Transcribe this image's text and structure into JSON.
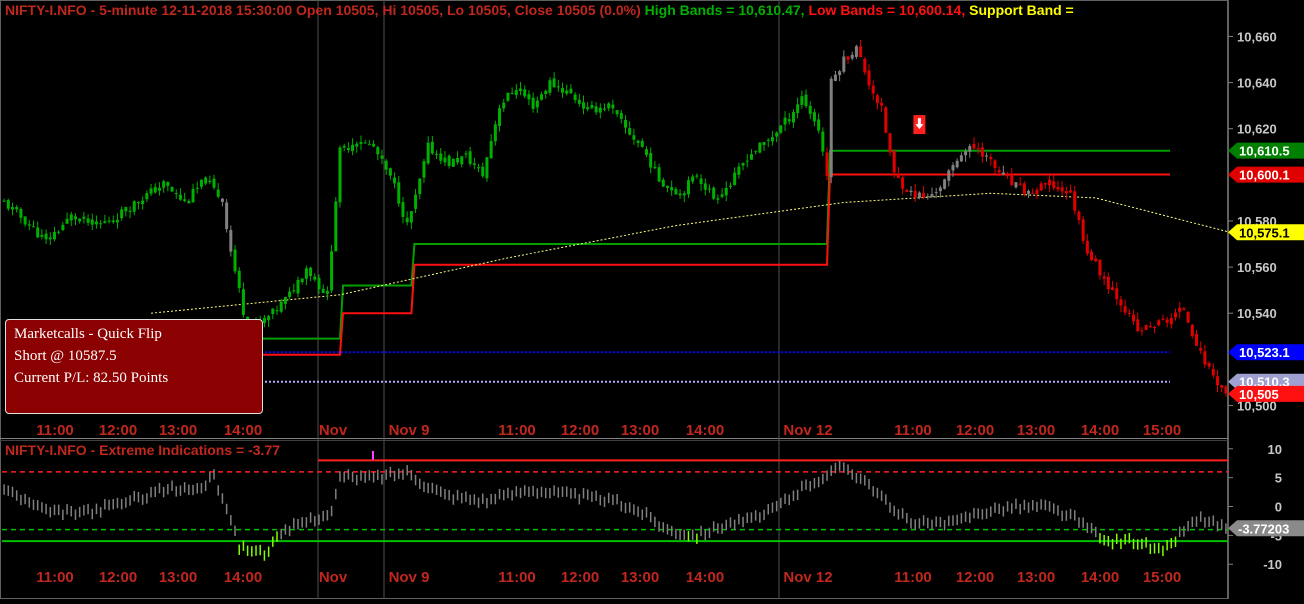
{
  "header": {
    "instrument": "NIFTY-I.NFO - 5-minute 12-11-2018 15:30:00 Open 10505, Hi 10505, Lo 10505, Close 10505 (0.0%)",
    "high_bands": "High Bands = 10,610.47,",
    "low_bands": "Low Bands = 10,600.14,",
    "support_band": "Support Band ="
  },
  "info_box": {
    "line1": "Marketcalls - Quick Flip",
    "line2": "Short @ 10587.5",
    "line3": "Current P/L: 82.50 Points"
  },
  "sub_header": {
    "label": "NIFTY-I.NFO - Extreme Indications = -3.77"
  },
  "colors": {
    "bull": "#00b000",
    "bear": "#e00000",
    "neutral": "#808080",
    "high_band": "#00a000",
    "low_band": "#ff1010",
    "ma": "#ffff80",
    "blue_level": "#0000ff",
    "lavender_level": "#b0a8ff",
    "axis_text": "#c8c8c8",
    "time_label": "#c0271d",
    "extreme": "#80ff00"
  },
  "chart_data": [
    {
      "type": "candlestick",
      "interval": "5-minute",
      "ylim": [
        10495,
        10668
      ],
      "y_ticks": [
        "10,660",
        "10,640",
        "10,620",
        "10,580",
        "10,560",
        "10,540",
        "10,500"
      ],
      "x_labels": [
        "11:00",
        "12:00",
        "13:00",
        "14:00",
        "Nov",
        "Nov 9",
        "11:00",
        "12:00",
        "13:00",
        "14:00",
        "Nov 12",
        "11:00",
        "12:00",
        "13:00",
        "14:00",
        "15:00"
      ],
      "series_path": [
        {
          "bar": 0,
          "price": 10588
        },
        {
          "bar": 5,
          "price": 10580
        },
        {
          "bar": 10,
          "price": 10571
        },
        {
          "bar": 16,
          "price": 10582
        },
        {
          "bar": 22,
          "price": 10578
        },
        {
          "bar": 26,
          "price": 10581
        },
        {
          "bar": 32,
          "price": 10589
        },
        {
          "bar": 38,
          "price": 10596
        },
        {
          "bar": 43,
          "price": 10588
        },
        {
          "bar": 48,
          "price": 10598
        },
        {
          "bar": 52,
          "price": 10589
        },
        {
          "bar": 54,
          "price": 10567
        },
        {
          "bar": 57,
          "price": 10541
        },
        {
          "bar": 60,
          "price": 10534
        },
        {
          "bar": 64,
          "price": 10540
        },
        {
          "bar": 68,
          "price": 10548
        },
        {
          "bar": 72,
          "price": 10560
        },
        {
          "bar": 75,
          "price": 10552
        },
        {
          "bar": 77,
          "price": 10548
        },
        {
          "bar": 80,
          "price": 10610
        },
        {
          "bar": 84,
          "price": 10615
        },
        {
          "bar": 88,
          "price": 10612
        },
        {
          "bar": 93,
          "price": 10595
        },
        {
          "bar": 96,
          "price": 10578
        },
        {
          "bar": 98,
          "price": 10590
        },
        {
          "bar": 101,
          "price": 10612
        },
        {
          "bar": 106,
          "price": 10605
        },
        {
          "bar": 110,
          "price": 10608
        },
        {
          "bar": 114,
          "price": 10600
        },
        {
          "bar": 118,
          "price": 10630
        },
        {
          "bar": 122,
          "price": 10638
        },
        {
          "bar": 126,
          "price": 10630
        },
        {
          "bar": 130,
          "price": 10640
        },
        {
          "bar": 135,
          "price": 10635
        },
        {
          "bar": 139,
          "price": 10628
        },
        {
          "bar": 144,
          "price": 10630
        },
        {
          "bar": 148,
          "price": 10620
        },
        {
          "bar": 152,
          "price": 10612
        },
        {
          "bar": 156,
          "price": 10598
        },
        {
          "bar": 161,
          "price": 10592
        },
        {
          "bar": 165,
          "price": 10600
        },
        {
          "bar": 169,
          "price": 10590
        },
        {
          "bar": 173,
          "price": 10596
        },
        {
          "bar": 177,
          "price": 10608
        },
        {
          "bar": 182,
          "price": 10615
        },
        {
          "bar": 187,
          "price": 10625
        },
        {
          "bar": 190,
          "price": 10634
        },
        {
          "bar": 194,
          "price": 10620
        },
        {
          "bar": 196,
          "price": 10600
        },
        {
          "bar": 197,
          "price": 10640
        },
        {
          "bar": 200,
          "price": 10650
        },
        {
          "bar": 203,
          "price": 10655
        },
        {
          "bar": 206,
          "price": 10640
        },
        {
          "bar": 209,
          "price": 10628
        },
        {
          "bar": 212,
          "price": 10600
        },
        {
          "bar": 216,
          "price": 10592
        },
        {
          "bar": 220,
          "price": 10590
        },
        {
          "bar": 224,
          "price": 10597
        },
        {
          "bar": 228,
          "price": 10610
        },
        {
          "bar": 232,
          "price": 10612
        },
        {
          "bar": 236,
          "price": 10603
        },
        {
          "bar": 240,
          "price": 10596
        },
        {
          "bar": 244,
          "price": 10592
        },
        {
          "bar": 249,
          "price": 10596
        },
        {
          "bar": 254,
          "price": 10592
        },
        {
          "bar": 258,
          "price": 10567
        },
        {
          "bar": 262,
          "price": 10555
        },
        {
          "bar": 266,
          "price": 10545
        },
        {
          "bar": 270,
          "price": 10532
        },
        {
          "bar": 274,
          "price": 10535
        },
        {
          "bar": 277,
          "price": 10537
        },
        {
          "bar": 281,
          "price": 10542
        },
        {
          "bar": 285,
          "price": 10522
        },
        {
          "bar": 288,
          "price": 10513
        },
        {
          "bar": 291,
          "price": 10505
        }
      ],
      "high_band_steps": [
        {
          "bar": 45,
          "value": 10529
        },
        {
          "bar": 80,
          "value": 10552
        },
        {
          "bar": 97,
          "value": 10570
        },
        {
          "bar": 196,
          "value": 10584
        },
        {
          "bar": 292,
          "value": 10610.47
        }
      ],
      "low_band_steps": [
        {
          "bar": 45,
          "value": 10522
        },
        {
          "bar": 80,
          "value": 10540
        },
        {
          "bar": 97,
          "value": 10561
        },
        {
          "bar": 196,
          "value": 10570
        },
        {
          "bar": 292,
          "value": 10600.14
        }
      ],
      "moving_average": [
        {
          "bar": 35,
          "value": 10540
        },
        {
          "bar": 80,
          "value": 10548
        },
        {
          "bar": 120,
          "value": 10564
        },
        {
          "bar": 160,
          "value": 10578
        },
        {
          "bar": 200,
          "value": 10588
        },
        {
          "bar": 235,
          "value": 10592
        },
        {
          "bar": 260,
          "value": 10590
        },
        {
          "bar": 292,
          "value": 10575.1
        }
      ],
      "horizontal_levels": [
        {
          "label": "10,523.1",
          "value": 10523.1,
          "style": "dotted-blue"
        },
        {
          "label": "10,510.3",
          "value": 10510.3,
          "style": "dotted-lavender"
        }
      ],
      "price_tags": [
        {
          "label": "10,610.5",
          "value": 10610.5,
          "bg": "#008000",
          "fg": "#ffffff"
        },
        {
          "label": "10,600.1",
          "value": 10600.1,
          "bg": "#e00000",
          "fg": "#ffffff"
        },
        {
          "label": "10,575.1",
          "value": 10575.1,
          "bg": "#ffff00",
          "fg": "#000000"
        },
        {
          "label": "10,523.1",
          "value": 10523.1,
          "bg": "#0000ff",
          "fg": "#ffffff"
        },
        {
          "label": "10,510.3",
          "value": 10510.3,
          "bg": "#a0a0d0",
          "fg": "#ffffff"
        },
        {
          "label": "10,505",
          "value": 10505,
          "bg": "#ff1010",
          "fg": "#ffffff"
        }
      ],
      "short_signal": {
        "bar": 218,
        "price": 10622
      }
    },
    {
      "type": "bar",
      "name": "Extreme Indications",
      "ylim": [
        -11,
        11
      ],
      "y_ticks": [
        "10",
        "5",
        "0",
        "-5",
        "-10"
      ],
      "levels": [
        {
          "value": 8,
          "style": "solid",
          "color": "red"
        },
        {
          "value": 6,
          "style": "dashed",
          "color": "red"
        },
        {
          "value": -4,
          "style": "dashed",
          "color": "green"
        },
        {
          "value": -6,
          "style": "solid",
          "color": "green"
        }
      ],
      "last_value_label": "-3.77203",
      "series_path": [
        {
          "bar": 0,
          "value": 3
        },
        {
          "bar": 5,
          "value": 1
        },
        {
          "bar": 10,
          "value": -1
        },
        {
          "bar": 20,
          "value": -1
        },
        {
          "bar": 30,
          "value": 1
        },
        {
          "bar": 38,
          "value": 3
        },
        {
          "bar": 46,
          "value": 3
        },
        {
          "bar": 50,
          "value": 5
        },
        {
          "bar": 53,
          "value": 0
        },
        {
          "bar": 56,
          "value": -7
        },
        {
          "bar": 62,
          "value": -8
        },
        {
          "bar": 66,
          "value": -5
        },
        {
          "bar": 70,
          "value": -3
        },
        {
          "bar": 78,
          "value": -1
        },
        {
          "bar": 80,
          "value": 5
        },
        {
          "bar": 88,
          "value": 5
        },
        {
          "bar": 96,
          "value": 6
        },
        {
          "bar": 100,
          "value": 4
        },
        {
          "bar": 105,
          "value": 2
        },
        {
          "bar": 115,
          "value": 1
        },
        {
          "bar": 125,
          "value": 3
        },
        {
          "bar": 135,
          "value": 2
        },
        {
          "bar": 145,
          "value": 1
        },
        {
          "bar": 152,
          "value": -1
        },
        {
          "bar": 158,
          "value": -4
        },
        {
          "bar": 165,
          "value": -5
        },
        {
          "bar": 172,
          "value": -3
        },
        {
          "bar": 180,
          "value": -2
        },
        {
          "bar": 186,
          "value": 1
        },
        {
          "bar": 192,
          "value": 4
        },
        {
          "bar": 200,
          "value": 7
        },
        {
          "bar": 206,
          "value": 4
        },
        {
          "bar": 212,
          "value": -1
        },
        {
          "bar": 218,
          "value": -3
        },
        {
          "bar": 226,
          "value": -3
        },
        {
          "bar": 232,
          "value": -1
        },
        {
          "bar": 240,
          "value": 0
        },
        {
          "bar": 248,
          "value": 0
        },
        {
          "bar": 255,
          "value": -2
        },
        {
          "bar": 262,
          "value": -6
        },
        {
          "bar": 270,
          "value": -6
        },
        {
          "bar": 276,
          "value": -8
        },
        {
          "bar": 281,
          "value": -4
        },
        {
          "bar": 285,
          "value": -2
        },
        {
          "bar": 291,
          "value": -3.77
        }
      ]
    }
  ]
}
